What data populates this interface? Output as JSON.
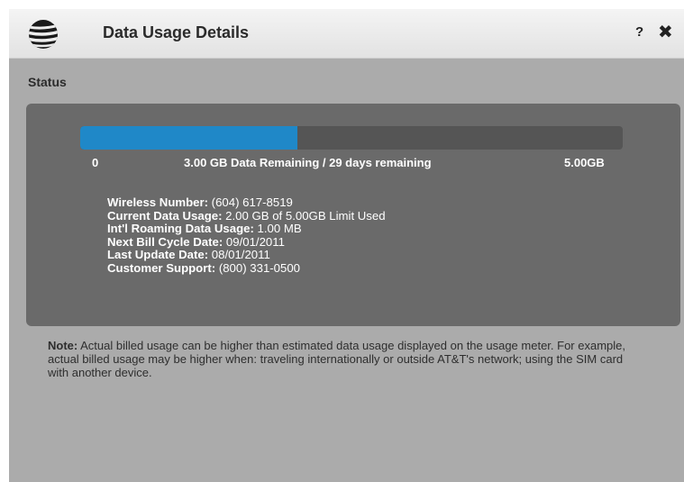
{
  "header": {
    "title": "Data Usage Details",
    "help_label": "?",
    "close_label": "✖",
    "logo_icon": "att-globe-logo"
  },
  "status": {
    "label": "Status",
    "progress_fraction": 0.4,
    "scale_min": "0",
    "scale_max": "5.00GB",
    "remaining_text": "3.00 GB Data Remaining / 29 days remaining",
    "bar_color": "#1f88c8"
  },
  "details": [
    {
      "label": "Wireless Number:",
      "value": " (604) 617-8519"
    },
    {
      "label": "Current Data Usage:",
      "value": " 2.00 GB of 5.00GB Limit Used"
    },
    {
      "label": "Int'l Roaming Data Usage:",
      "value": " 1.00 MB"
    },
    {
      "label": "Next Bill Cycle Date:",
      "value": " 09/01/2011"
    },
    {
      "label": "Last Update Date:",
      "value": " 08/01/2011"
    },
    {
      "label": "Customer Support:",
      "value": " (800) 331-0500"
    }
  ],
  "note": {
    "label": "Note:",
    "text": " Actual billed usage can be higher than estimated data usage displayed on the usage meter. For example, actual billed usage may be higher when: traveling internationally or outside AT&T's network; using the SIM card with another device."
  }
}
